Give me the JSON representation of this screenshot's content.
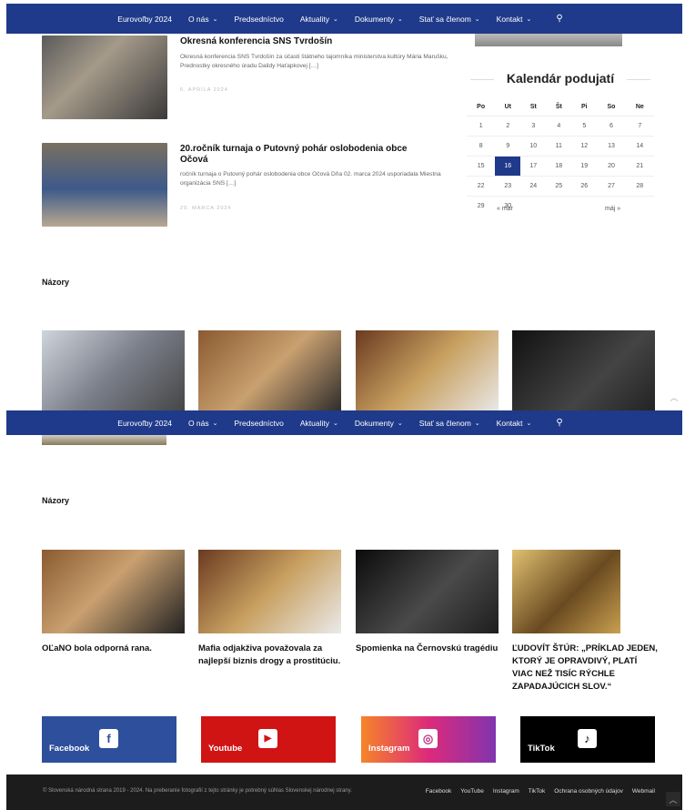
{
  "nav": {
    "items": [
      {
        "label": "Eurovoľby 2024",
        "dropdown": false
      },
      {
        "label": "O nás",
        "dropdown": true
      },
      {
        "label": "Predsedníctvo",
        "dropdown": false
      },
      {
        "label": "Aktuality",
        "dropdown": true
      },
      {
        "label": "Dokumenty",
        "dropdown": true
      },
      {
        "label": "Stať sa členom",
        "dropdown": true
      },
      {
        "label": "Kontakt",
        "dropdown": true
      }
    ],
    "search_icon": "search-icon"
  },
  "posts": [
    {
      "title": "Okresná konferencia SNS Tvrdošín",
      "excerpt": "Okresná konferencia SNS Tvrdošín za účasti štátneho tajomníka ministerstva kultúry Mária Marušku, Prednostky okresného úradu Dalidy Haťapkovej […]",
      "date": "6. APRÍLA 2024"
    },
    {
      "title": "20.ročník turnaja o Putovný pohár oslobodenia obce Očová",
      "excerpt": "ročník turnaja o Putovný pohár oslobodenia obce Očová  Dňa 02. marca 2024 usporiadala Miestna organizácia SNS […]",
      "date": "29. MARCA 2024"
    }
  ],
  "calendar": {
    "title": "Kalendár podujatí",
    "days": [
      "Po",
      "Ut",
      "St",
      "Št",
      "Pi",
      "So",
      "Ne"
    ],
    "weeks": [
      [
        "1",
        "2",
        "3",
        "4",
        "5",
        "6",
        "7"
      ],
      [
        "8",
        "9",
        "10",
        "11",
        "12",
        "13",
        "14"
      ],
      [
        "15",
        "16",
        "17",
        "18",
        "19",
        "20",
        "21"
      ],
      [
        "22",
        "23",
        "24",
        "25",
        "26",
        "27",
        "28"
      ],
      [
        "29",
        "30",
        "",
        "",
        "",
        "",
        ""
      ]
    ],
    "today": "16",
    "prev": "« mar",
    "next": "máj »"
  },
  "opinions": {
    "title": "Názory",
    "items": [
      {
        "title": "OĽaNO bola odporná rana."
      },
      {
        "title": "Mafia odjakživa považovala za najlepší biznis drogy a prostitúciu."
      },
      {
        "title": "Spomienka na Černovskú tragédiu"
      },
      {
        "title": "ĽUDOVÍT ŠTÚR: „PRÍKLAD JEDEN, KTORÝ JE OPRAVDIVÝ, PLATÍ VIAC NEŽ TISÍC RÝCHLE ZAPADAJÚCICH SLOV.“"
      }
    ]
  },
  "social": [
    {
      "label": "Facebook",
      "icon": "facebook-icon",
      "glyph": "f",
      "color": "#2d4f9c"
    },
    {
      "label": "Youtube",
      "icon": "youtube-icon",
      "glyph": "▶",
      "color": "#d01414"
    },
    {
      "label": "Instagram",
      "icon": "instagram-icon",
      "glyph": "◎",
      "color": "#c13584"
    },
    {
      "label": "TikTok",
      "icon": "tiktok-icon",
      "glyph": "♪",
      "color": "#000000"
    }
  ],
  "footer": {
    "copyright": "© Slovenská národná strana 2019 - 2024. Na preberanie fotografií z tejto stránky je potrebný súhlas Slovenskej národnej strany.",
    "links": [
      "Facebook",
      "YouTube",
      "Instagram",
      "TikTok",
      "Ochrana osobných údajov",
      "Webmail"
    ]
  },
  "colors": {
    "accent": "#1f3a8a",
    "footer": "#1c1c1c"
  }
}
